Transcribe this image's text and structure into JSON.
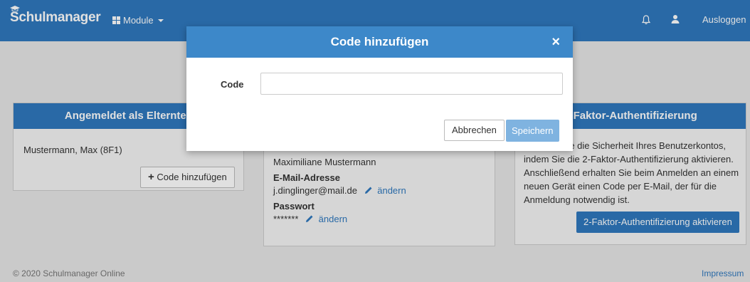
{
  "navbar": {
    "brand": "Schulmanager",
    "modules_label": "Module",
    "logout_label": "Ausloggen"
  },
  "left_panel": {
    "title": "Angemeldet als Elternteil",
    "user_name": "Mustermann, Max (8F1)",
    "add_code_label": "Code hinzufügen"
  },
  "mid_panel": {
    "name": "Maximiliane Mustermann",
    "email_label": "E-Mail-Adresse",
    "email_value": "j.dinglinger@mail.de",
    "edit_label": "ändern",
    "password_label": "Passwort",
    "password_value": "*******"
  },
  "right_panel": {
    "title": "2-Faktor-Authentifizierung",
    "text": "Erhöhen Sie die Sicherheit Ihres Benutzerkontos, indem Sie die 2-Faktor-Authentifizierung aktivieren. Anschließend erhalten Sie beim Anmelden an einem neuen Gerät einen Code per E-Mail, der für die Anmeldung notwendig ist.",
    "button_label": "2-Faktor-Authentifizierung aktivieren"
  },
  "footer": {
    "copyright": "© 2020 Schulmanager Online",
    "impressum": "Impressum"
  },
  "modal": {
    "title": "Code hinzufügen",
    "close": "×",
    "code_label": "Code",
    "code_value": "",
    "cancel_label": "Abbrechen",
    "save_label": "Speichern"
  },
  "colors": {
    "primary": "#2f78bd",
    "modal_header": "#3d88c9",
    "save_disabled": "#7fb3e0"
  }
}
